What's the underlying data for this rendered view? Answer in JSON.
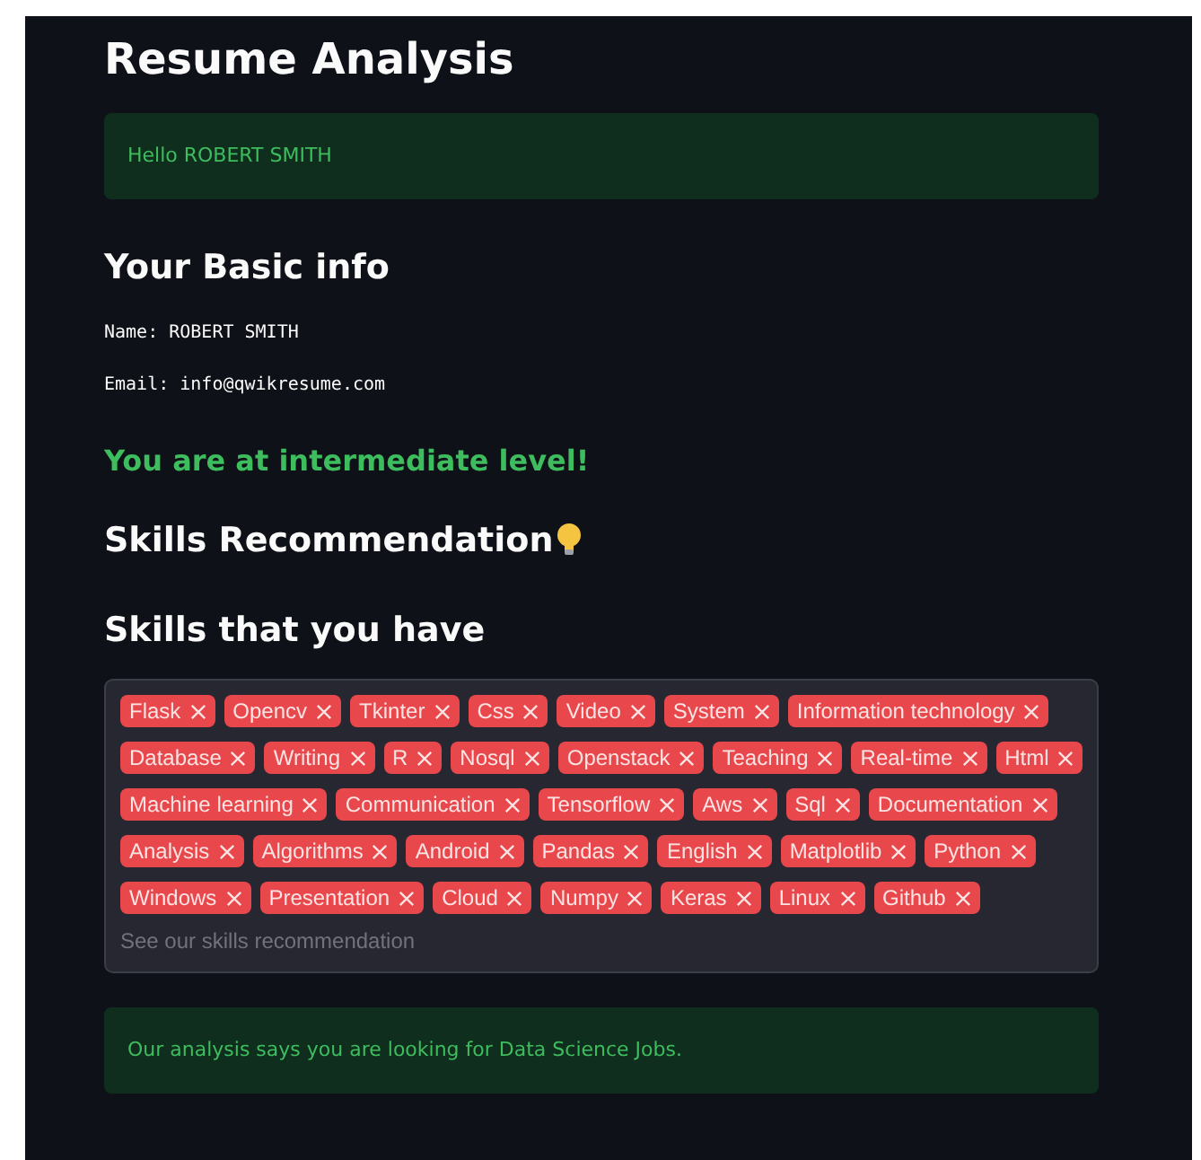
{
  "title": "Resume Analysis",
  "greeting": "Hello ROBERT SMITH",
  "basic_info": {
    "heading": "Your Basic info",
    "lines": [
      "Name: ROBERT SMITH",
      "Email: info@qwikresume.com"
    ]
  },
  "level_message": "You are at intermediate level!",
  "recommendation_heading": "Skills Recommendation",
  "skills_heading": "Skills that you have",
  "skills": [
    "Flask",
    "Opencv",
    "Tkinter",
    "Css",
    "Video",
    "System",
    "Information technology",
    "Database",
    "Writing",
    "R",
    "Nosql",
    "Openstack",
    "Teaching",
    "Real-time",
    "Html",
    "Machine learning",
    "Communication",
    "Tensorflow",
    "Aws",
    "Sql",
    "Documentation",
    "Analysis",
    "Algorithms",
    "Android",
    "Pandas",
    "English",
    "Matplotlib",
    "Python",
    "Windows",
    "Presentation",
    "Cloud",
    "Numpy",
    "Keras",
    "Linux",
    "Github"
  ],
  "skills_placeholder": "See our skills recommendation",
  "analysis_message": "Our analysis says you are looking for Data Science Jobs."
}
